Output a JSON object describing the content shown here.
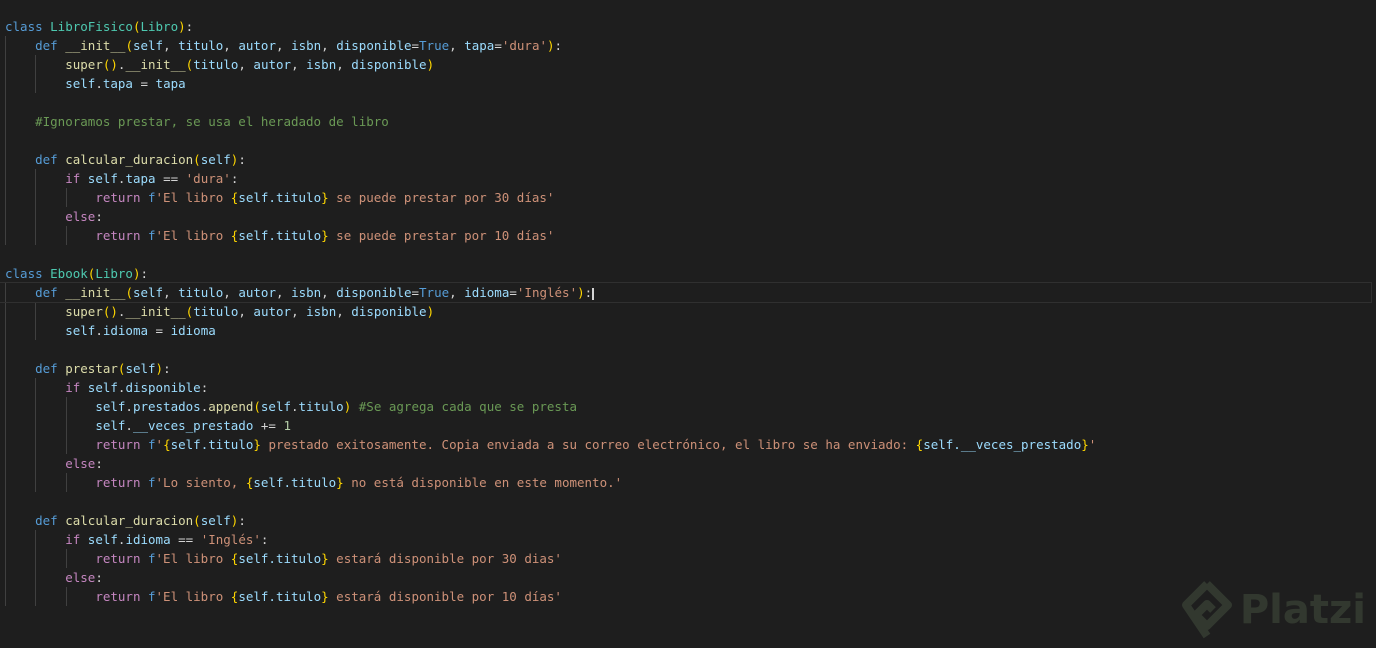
{
  "editor": {
    "current_line": 15,
    "watermark": "Platzi",
    "lines": [
      [
        [
          "k",
          "class "
        ],
        [
          "c",
          "LibroFisico"
        ],
        [
          "p",
          "("
        ],
        [
          "c",
          "Libro"
        ],
        [
          "p",
          ")"
        ],
        [
          "w",
          ":"
        ]
      ],
      [
        [
          "w",
          "    "
        ],
        [
          "k",
          "def "
        ],
        [
          "f",
          "__init__"
        ],
        [
          "p",
          "("
        ],
        [
          "v",
          "self"
        ],
        [
          "w",
          ", "
        ],
        [
          "v",
          "titulo"
        ],
        [
          "w",
          ", "
        ],
        [
          "v",
          "autor"
        ],
        [
          "w",
          ", "
        ],
        [
          "v",
          "isbn"
        ],
        [
          "w",
          ", "
        ],
        [
          "v",
          "disponible"
        ],
        [
          "w",
          "="
        ],
        [
          "k",
          "True"
        ],
        [
          "w",
          ", "
        ],
        [
          "v",
          "tapa"
        ],
        [
          "w",
          "="
        ],
        [
          "s",
          "'dura'"
        ],
        [
          "p",
          ")"
        ],
        [
          "w",
          ":"
        ]
      ],
      [
        [
          "w",
          "        "
        ],
        [
          "f",
          "super"
        ],
        [
          "p",
          "()"
        ],
        [
          "w",
          "."
        ],
        [
          "f",
          "__init__"
        ],
        [
          "p",
          "("
        ],
        [
          "v",
          "titulo"
        ],
        [
          "w",
          ", "
        ],
        [
          "v",
          "autor"
        ],
        [
          "w",
          ", "
        ],
        [
          "v",
          "isbn"
        ],
        [
          "w",
          ", "
        ],
        [
          "v",
          "disponible"
        ],
        [
          "p",
          ")"
        ]
      ],
      [
        [
          "w",
          "        "
        ],
        [
          "v",
          "self"
        ],
        [
          "w",
          "."
        ],
        [
          "v",
          "tapa"
        ],
        [
          "w",
          " = "
        ],
        [
          "v",
          "tapa"
        ]
      ],
      [],
      [
        [
          "w",
          "    "
        ],
        [
          "m",
          "#Ignoramos prestar, se usa el heradado de libro"
        ]
      ],
      [],
      [
        [
          "w",
          "    "
        ],
        [
          "k",
          "def "
        ],
        [
          "f",
          "calcular_duracion"
        ],
        [
          "p",
          "("
        ],
        [
          "v",
          "self"
        ],
        [
          "p",
          ")"
        ],
        [
          "w",
          ":"
        ]
      ],
      [
        [
          "w",
          "        "
        ],
        [
          "ctl",
          "if "
        ],
        [
          "v",
          "self"
        ],
        [
          "w",
          "."
        ],
        [
          "v",
          "tapa"
        ],
        [
          "w",
          " == "
        ],
        [
          "s",
          "'dura'"
        ],
        [
          "w",
          ":"
        ]
      ],
      [
        [
          "w",
          "            "
        ],
        [
          "ctl",
          "return "
        ],
        [
          "k",
          "f"
        ],
        [
          "s",
          "'El libro "
        ],
        [
          "p",
          "{"
        ],
        [
          "v",
          "self.titulo"
        ],
        [
          "p",
          "}"
        ],
        [
          "s",
          " se puede prestar por 30 días'"
        ]
      ],
      [
        [
          "w",
          "        "
        ],
        [
          "ctl",
          "else"
        ],
        [
          "w",
          ":"
        ]
      ],
      [
        [
          "w",
          "            "
        ],
        [
          "ctl",
          "return "
        ],
        [
          "k",
          "f"
        ],
        [
          "s",
          "'El libro "
        ],
        [
          "p",
          "{"
        ],
        [
          "v",
          "self.titulo"
        ],
        [
          "p",
          "}"
        ],
        [
          "s",
          " se puede prestar por 10 días'"
        ]
      ],
      [],
      [
        [
          "k",
          "class "
        ],
        [
          "c",
          "Ebook"
        ],
        [
          "p",
          "("
        ],
        [
          "c",
          "Libro"
        ],
        [
          "p",
          ")"
        ],
        [
          "w",
          ":"
        ]
      ],
      [
        [
          "w",
          "    "
        ],
        [
          "k",
          "def "
        ],
        [
          "f",
          "__init__"
        ],
        [
          "p",
          "("
        ],
        [
          "v",
          "self"
        ],
        [
          "w",
          ", "
        ],
        [
          "v",
          "titulo"
        ],
        [
          "w",
          ", "
        ],
        [
          "v",
          "autor"
        ],
        [
          "w",
          ", "
        ],
        [
          "v",
          "isbn"
        ],
        [
          "w",
          ", "
        ],
        [
          "v",
          "disponible"
        ],
        [
          "w",
          "="
        ],
        [
          "k",
          "True"
        ],
        [
          "w",
          ", "
        ],
        [
          "v",
          "idioma"
        ],
        [
          "w",
          "="
        ],
        [
          "s",
          "'Inglés'"
        ],
        [
          "p",
          ")"
        ],
        [
          "w",
          ":"
        ]
      ],
      [
        [
          "w",
          "        "
        ],
        [
          "f",
          "super"
        ],
        [
          "p",
          "()"
        ],
        [
          "w",
          "."
        ],
        [
          "f",
          "__init__"
        ],
        [
          "p",
          "("
        ],
        [
          "v",
          "titulo"
        ],
        [
          "w",
          ", "
        ],
        [
          "v",
          "autor"
        ],
        [
          "w",
          ", "
        ],
        [
          "v",
          "isbn"
        ],
        [
          "w",
          ", "
        ],
        [
          "v",
          "disponible"
        ],
        [
          "p",
          ")"
        ]
      ],
      [
        [
          "w",
          "        "
        ],
        [
          "v",
          "self"
        ],
        [
          "w",
          "."
        ],
        [
          "v",
          "idioma"
        ],
        [
          "w",
          " = "
        ],
        [
          "v",
          "idioma"
        ]
      ],
      [],
      [
        [
          "w",
          "    "
        ],
        [
          "k",
          "def "
        ],
        [
          "f",
          "prestar"
        ],
        [
          "p",
          "("
        ],
        [
          "v",
          "self"
        ],
        [
          "p",
          ")"
        ],
        [
          "w",
          ":"
        ]
      ],
      [
        [
          "w",
          "        "
        ],
        [
          "ctl",
          "if "
        ],
        [
          "v",
          "self"
        ],
        [
          "w",
          "."
        ],
        [
          "v",
          "disponible"
        ],
        [
          "w",
          ":"
        ]
      ],
      [
        [
          "w",
          "            "
        ],
        [
          "v",
          "self"
        ],
        [
          "w",
          "."
        ],
        [
          "v",
          "prestados"
        ],
        [
          "w",
          "."
        ],
        [
          "f",
          "append"
        ],
        [
          "p",
          "("
        ],
        [
          "v",
          "self"
        ],
        [
          "w",
          "."
        ],
        [
          "v",
          "titulo"
        ],
        [
          "p",
          ")"
        ],
        [
          "w",
          " "
        ],
        [
          "m",
          "#Se agrega cada que se presta"
        ]
      ],
      [
        [
          "w",
          "            "
        ],
        [
          "v",
          "self"
        ],
        [
          "w",
          "."
        ],
        [
          "v",
          "__veces_prestado"
        ],
        [
          "w",
          " += "
        ],
        [
          "n",
          "1"
        ]
      ],
      [
        [
          "w",
          "            "
        ],
        [
          "ctl",
          "return "
        ],
        [
          "k",
          "f"
        ],
        [
          "s",
          "'"
        ],
        [
          "p",
          "{"
        ],
        [
          "v",
          "self.titulo"
        ],
        [
          "p",
          "}"
        ],
        [
          "s",
          " prestado exitosamente. Copia enviada a su correo electrónico, el libro se ha enviado: "
        ],
        [
          "p",
          "{"
        ],
        [
          "v",
          "self.__veces_prestado"
        ],
        [
          "p",
          "}"
        ],
        [
          "s",
          "'"
        ]
      ],
      [
        [
          "w",
          "        "
        ],
        [
          "ctl",
          "else"
        ],
        [
          "w",
          ":"
        ]
      ],
      [
        [
          "w",
          "            "
        ],
        [
          "ctl",
          "return "
        ],
        [
          "k",
          "f"
        ],
        [
          "s",
          "'Lo siento, "
        ],
        [
          "p",
          "{"
        ],
        [
          "v",
          "self.titulo"
        ],
        [
          "p",
          "}"
        ],
        [
          "s",
          " no está disponible en este momento.'"
        ]
      ],
      [],
      [
        [
          "w",
          "    "
        ],
        [
          "k",
          "def "
        ],
        [
          "f",
          "calcular_duracion"
        ],
        [
          "p",
          "("
        ],
        [
          "v",
          "self"
        ],
        [
          "p",
          ")"
        ],
        [
          "w",
          ":"
        ]
      ],
      [
        [
          "w",
          "        "
        ],
        [
          "ctl",
          "if "
        ],
        [
          "v",
          "self"
        ],
        [
          "w",
          "."
        ],
        [
          "v",
          "idioma"
        ],
        [
          "w",
          " == "
        ],
        [
          "s",
          "'Inglés'"
        ],
        [
          "w",
          ":"
        ]
      ],
      [
        [
          "w",
          "            "
        ],
        [
          "ctl",
          "return "
        ],
        [
          "k",
          "f"
        ],
        [
          "s",
          "'El libro "
        ],
        [
          "p",
          "{"
        ],
        [
          "v",
          "self.titulo"
        ],
        [
          "p",
          "}"
        ],
        [
          "s",
          " estará disponible por 30 dias'"
        ]
      ],
      [
        [
          "w",
          "        "
        ],
        [
          "ctl",
          "else"
        ],
        [
          "w",
          ":"
        ]
      ],
      [
        [
          "w",
          "            "
        ],
        [
          "ctl",
          "return "
        ],
        [
          "k",
          "f"
        ],
        [
          "s",
          "'El libro "
        ],
        [
          "p",
          "{"
        ],
        [
          "v",
          "self.titulo"
        ],
        [
          "p",
          "}"
        ],
        [
          "s",
          " estará disponible por 10 días'"
        ]
      ]
    ]
  }
}
